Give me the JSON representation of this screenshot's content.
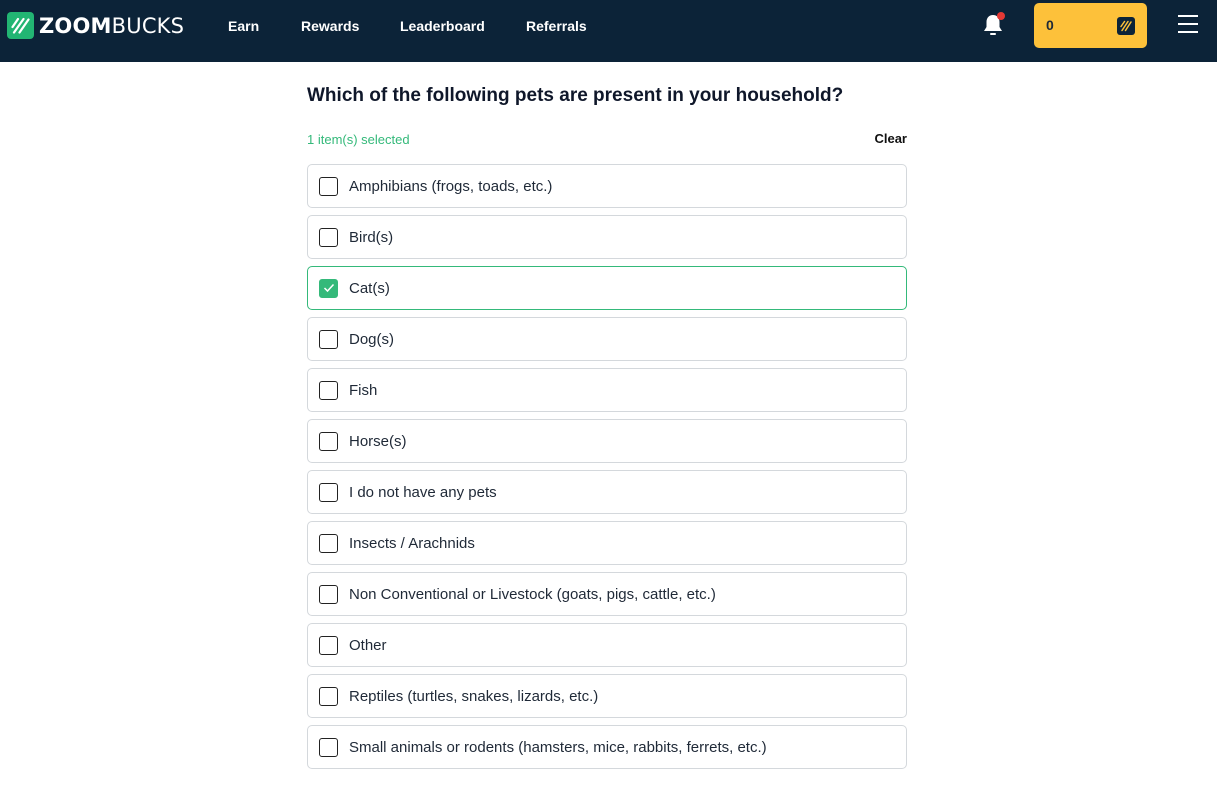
{
  "header": {
    "brand_bold": "ZOOM",
    "brand_light": "BUCKS",
    "nav": [
      "Earn",
      "Rewards",
      "Leaderboard",
      "Referrals"
    ],
    "points": "0",
    "notification_dot_color": "#e53935",
    "brand_color": "#22b573",
    "points_color": "#fdc13a"
  },
  "question": {
    "title": "Which of the following pets are present in your household?",
    "selected_text": "1 item(s) selected",
    "clear_label": "Clear",
    "options": [
      {
        "label": "Amphibians (frogs, toads, etc.)",
        "checked": false
      },
      {
        "label": "Bird(s)",
        "checked": false
      },
      {
        "label": "Cat(s)",
        "checked": true
      },
      {
        "label": "Dog(s)",
        "checked": false
      },
      {
        "label": "Fish",
        "checked": false
      },
      {
        "label": "Horse(s)",
        "checked": false
      },
      {
        "label": "I do not have any pets",
        "checked": false
      },
      {
        "label": "Insects / Arachnids",
        "checked": false
      },
      {
        "label": "Non Conventional or Livestock (goats, pigs, cattle, etc.)",
        "checked": false
      },
      {
        "label": "Other",
        "checked": false
      },
      {
        "label": "Reptiles (turtles, snakes, lizards, etc.)",
        "checked": false
      },
      {
        "label": "Small animals or rodents (hamsters, mice, rabbits, ferrets, etc.)",
        "checked": false
      }
    ]
  }
}
